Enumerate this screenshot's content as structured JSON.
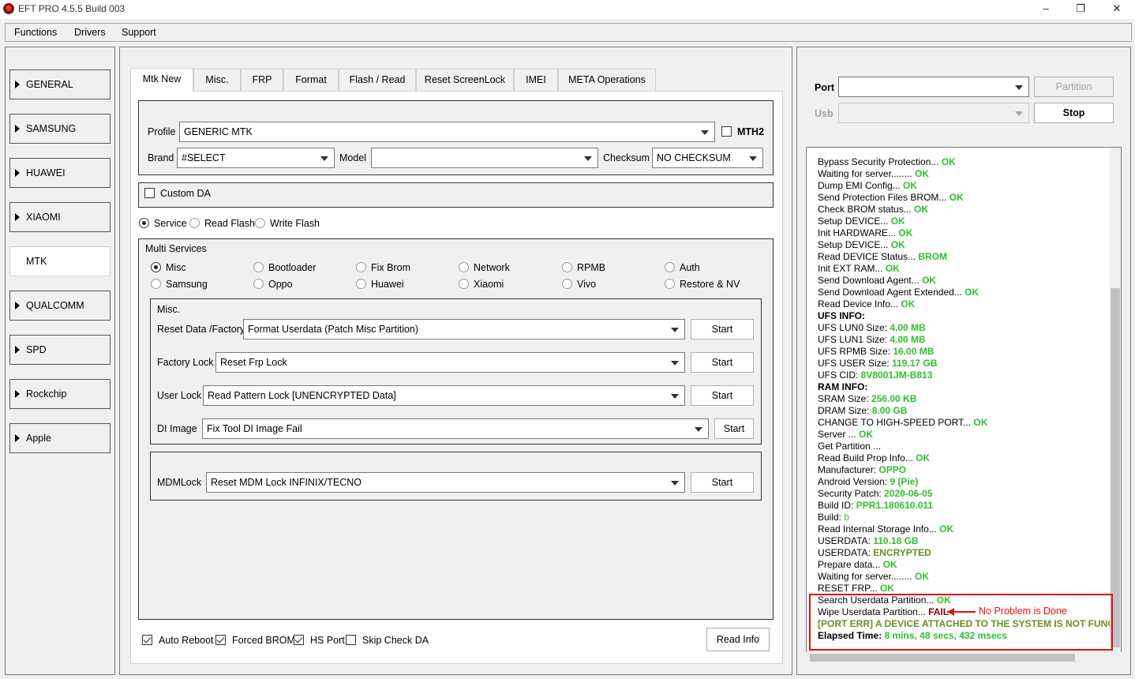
{
  "window": {
    "title": "EFT PRO 4.5.5 Build 003",
    "controls": [
      "–",
      "❐",
      "✕"
    ]
  },
  "menu": [
    "Functions",
    "Drivers",
    "Support"
  ],
  "nav": [
    "GENERAL",
    "SAMSUNG",
    "HUAWEI",
    "XIAOMI",
    "MTK",
    "QUALCOMM",
    "SPD",
    "Rockchip",
    "Apple"
  ],
  "nav_active": "MTK",
  "tabs": [
    "Mtk New",
    "Misc.",
    "FRP",
    "Format",
    "Flash / Read",
    "Reset ScreenLock",
    "IMEI",
    "META Operations"
  ],
  "tab_active": "Mtk New",
  "profile": {
    "label": "Profile",
    "value": "GENERIC MTK",
    "mth2_label": "MTH2"
  },
  "brand": {
    "label": "Brand",
    "value": "#SELECT"
  },
  "model": {
    "label": "Model",
    "value": ""
  },
  "checksum": {
    "label": "Checksum",
    "value": "NO CHECKSUM"
  },
  "custom_da": {
    "label": "Custom DA"
  },
  "mode": {
    "options": [
      "Service",
      "Read Flash",
      "Write Flash"
    ],
    "selected": "Service"
  },
  "multi_services": {
    "title": "Multi Services",
    "options": [
      "Misc",
      "Bootloader",
      "Fix Brom",
      "Network",
      "RPMB",
      "Auth",
      "Samsung",
      "Oppo",
      "Huawei",
      "Xiaomi",
      "Vivo",
      "Restore & NV"
    ],
    "selected": "Misc"
  },
  "misc": {
    "title": "Misc.",
    "rows": [
      {
        "label": "Reset Data /Factory",
        "value": "Format Userdata (Patch Misc Partition)",
        "button": "Start"
      },
      {
        "label": "Factory Lock",
        "value": "Reset Frp Lock",
        "button": "Start"
      },
      {
        "label": "User Lock",
        "value": "Read Pattern Lock [UNENCRYPTED Data]",
        "button": "Start"
      },
      {
        "label": "DI Image",
        "value": "Fix Tool DI Image Fail",
        "button": "Start"
      }
    ]
  },
  "mdm": {
    "label": "MDMLock",
    "value": "Reset MDM Lock INFINIX/TECNO",
    "button": "Start"
  },
  "options": [
    {
      "label": "Auto Reboot",
      "checked": true
    },
    {
      "label": "Forced BROM",
      "checked": true
    },
    {
      "label": "HS Port",
      "checked": true
    },
    {
      "label": "Skip Check DA",
      "checked": false
    }
  ],
  "read_info_button": "Read Info",
  "right": {
    "port_label": "Port",
    "usb_label": "Usb",
    "partition_button": "Partition",
    "stop_button": "Stop"
  },
  "log": [
    {
      "text": "Bypass Security Protection... ",
      "status": "OK",
      "cls": "ok"
    },
    {
      "text": "Waiting for server........ ",
      "status": "OK",
      "cls": "ok"
    },
    {
      "text": "Dump EMI Config... ",
      "status": "OK",
      "cls": "ok"
    },
    {
      "text": "Send Protection Files BROM... ",
      "status": "OK",
      "cls": "ok"
    },
    {
      "text": "Check BROM status... ",
      "status": "OK",
      "cls": "ok"
    },
    {
      "text": "Setup DEVICE... ",
      "status": "OK",
      "cls": "ok"
    },
    {
      "text": "Init HARDWARE... ",
      "status": "OK",
      "cls": "ok"
    },
    {
      "text": "Setup DEVICE... ",
      "status": "OK",
      "cls": "ok"
    },
    {
      "text": "Read DEVICE Status... ",
      "status": "BROM",
      "cls": "ok"
    },
    {
      "text": "Init EXT RAM... ",
      "status": "OK",
      "cls": "ok"
    },
    {
      "text": "Send Download Agent... ",
      "status": "OK",
      "cls": "ok"
    },
    {
      "text": "Send Download Agent Extended... ",
      "status": "OK",
      "cls": "ok"
    },
    {
      "text": "Read Device Info... ",
      "status": "OK",
      "cls": "ok"
    },
    {
      "text": "UFS INFO:",
      "status": "",
      "cls": "bold"
    },
    {
      "text": "UFS LUN0 Size: ",
      "status": "4.00 MB",
      "cls": "ok"
    },
    {
      "text": "UFS LUN1 Size: ",
      "status": "4.00 MB",
      "cls": "ok"
    },
    {
      "text": "UFS RPMB Size: ",
      "status": "16.00 MB",
      "cls": "ok"
    },
    {
      "text": "UFS USER Size: ",
      "status": "119.17 GB",
      "cls": "ok"
    },
    {
      "text": "UFS CID: ",
      "status": "8V8001JM-B813",
      "cls": "ok"
    },
    {
      "text": "RAM INFO:",
      "status": "",
      "cls": "bold"
    },
    {
      "text": "SRAM Size: ",
      "status": "256.00 KB",
      "cls": "ok"
    },
    {
      "text": "DRAM Size: ",
      "status": "8.00 GB",
      "cls": "ok"
    },
    {
      "text": "CHANGE TO HIGH-SPEED PORT... ",
      "status": "OK",
      "cls": "ok"
    },
    {
      "text": "Server ... ",
      "status": "OK",
      "cls": "ok"
    },
    {
      "text": "Get Partition ...",
      "status": "",
      "cls": ""
    },
    {
      "text": "Read Build Prop Info... ",
      "status": "OK",
      "cls": "ok"
    },
    {
      "text": " Manufacturer: ",
      "status": "OPPO",
      "cls": "ok"
    },
    {
      "text": " Android Version: ",
      "status": "9 (Pie)",
      "cls": "ok"
    },
    {
      "text": " Security Patch: ",
      "status": "2020-06-05",
      "cls": "ok"
    },
    {
      "text": " Build ID: ",
      "status": "PPR1.180610.011",
      "cls": "ok"
    },
    {
      "text": " Build: ",
      "status": "b",
      "cls": "green"
    },
    {
      "text": "Read Internal Storage Info... ",
      "status": "OK",
      "cls": "ok"
    },
    {
      "text": "USERDATA: ",
      "status": "110.18 GB",
      "cls": "ok"
    },
    {
      "text": "USERDATA: ",
      "status": "ENCRYPTED",
      "cls": "olive"
    },
    {
      "text": "Prepare data... ",
      "status": "OK",
      "cls": "ok"
    },
    {
      "text": "Waiting for server........ ",
      "status": "OK",
      "cls": "ok"
    },
    {
      "text": "RESET FRP... ",
      "status": "OK",
      "cls": "ok"
    },
    {
      "text": "Search Userdata Partition... ",
      "status": "OK",
      "cls": "ok"
    },
    {
      "text": "Wipe Userdata Partition... ",
      "status": "FAIL",
      "cls": "fail"
    },
    {
      "text": "",
      "status": "  [PORT ERR] A DEVICE ATTACHED TO THE SYSTEM IS NOT FUNCT",
      "cls": "olive"
    },
    {
      "text": "Elapsed Time: ",
      "status": "8 mins, 48 secs, 432 msecs",
      "cls": "ok"
    }
  ],
  "annotation": "No Problem is Done",
  "colors": {
    "ok": "#2fbf2f",
    "fail": "#8b0000",
    "annotation": "#e01010"
  }
}
